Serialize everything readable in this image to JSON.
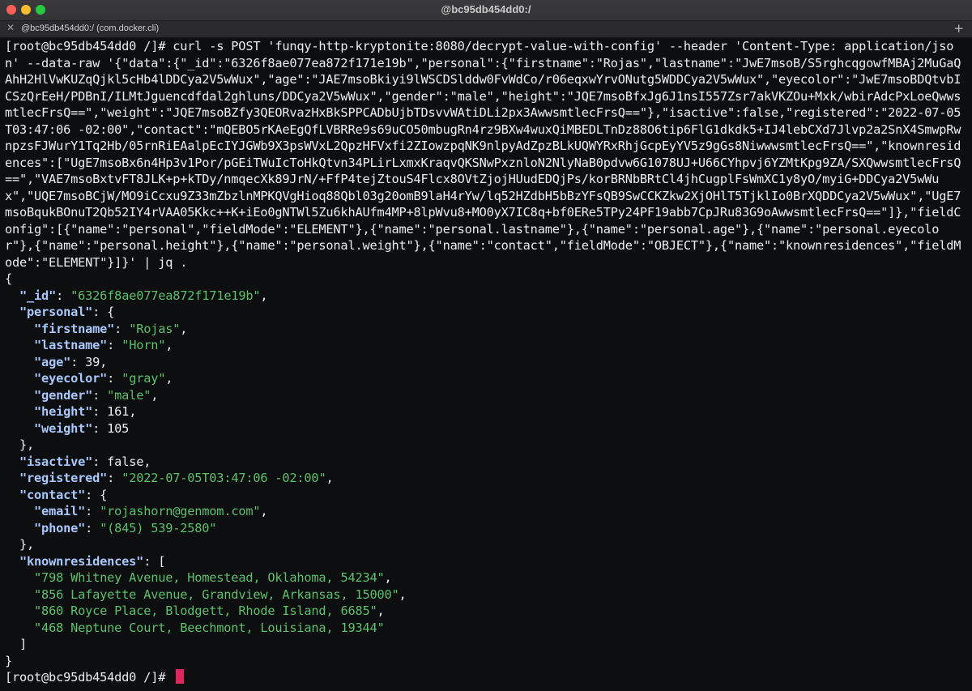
{
  "window": {
    "title": "@bc95db454dd0:/",
    "tab_title": "@bc95db454dd0:/ (com.docker.cli)",
    "tab_close": "✕",
    "tab_add": "+"
  },
  "terminal": {
    "command": "[root@bc95db454dd0 /]# curl -s POST 'funqy-http-kryptonite:8080/decrypt-value-with-config' --header 'Content-Type: application/json' --data-raw '{\"data\":{\"_id\":\"6326f8ae077ea872f171e19b\",\"personal\":{\"firstname\":\"Rojas\",\"lastname\":\"JwE7msoB/S5rghcqgowfMBAj2MuGaQAhH2HlVwKUZqQjkl5cHb4lDDCya2V5wWux\",\"age\":\"JAE7msoBkiyi9lWSCDSlddw0FvWdCo/r06eqxwYrvONutg5WDDCya2V5wWux\",\"eyecolor\":\"JwE7msoBDQtvbICSzQrEeH/PDBnI/ILMtJguencdfdal2ghluns/DDCya2V5wWux\",\"gender\":\"male\",\"height\":\"JQE7msoBfxJg6J1nsI557Zsr7akVKZOu+Mxk/wbirAdcPxLoeQwwsmtlecFrsQ==\",\"weight\":\"JQE7msoBZfy3QEORvazHxBkSPPCADbUjbTDsvvWAtiDLi2px3AwwsmtlecFrsQ==\"},\"isactive\":false,\"registered\":\"2022-07-05T03:47:06 -02:00\",\"contact\":\"mQEBO5rKAeEgQfLVBRRe9s69uCO50mbugRn4rz9BXw4wuxQiMBEDLTnDz88O6tip6FlG1dkdk5+IJ4lebCXd7Jlvp2a2SnX4SmwpRwnpzsFJWurY1Tq2Hb/05rnRiEAalpEcIYJGWb9X3psWVxL2QpzHFVxfi2ZIowzpqNK9nlpyAdZpzBLkUQWYRxRhjGcpEyYV5z9gGs8NiwwwsmtlecFrsQ==\",\"knownresidences\":[\"UgE7msoBx6n4Hp3v1Por/pGEiTWuIcToHkQtvn34PLirLxmxKraqvQKSNwPxznloN2NlyNaB0pdvw6G1078UJ+U66CYhpvj6YZMtKpg9ZA/SXQwwsmtlecFrsQ==\",\"VAE7msoBxtvFT8JLK+p+kTDy/nmqecXk89JrN/+FfP4tejZtouS4Flcx8OVtZjojHUudEDQjPs/korBRNbBRtCl4jhCugplFsWmXC1y8yO/myiG+DDCya2V5wWux\",\"UQE7msoBCjW/MO9iCcxu9Z33mZbzlnMPKQVgHioq88Qbl03g20omB9laH4rYw/lq52HZdbH5bBzYFsQB9SwCCKZkw2XjOHlT5TjklIo0BrXQDDCya2V5wWux\",\"UgE7msoBqukBOnuT2Qb52IY4rVAA05Kkc++K+iEo0gNTWl5Zu6khAUfm4MP+8lpWvu8+MO0yX7IC8q+bf0ERe5TPy24PF19abb7CpJRu83G9oAwwsmtlecFrsQ==\"]},\"fieldConfig\":[{\"name\":\"personal\",\"fieldMode\":\"ELEMENT\"},{\"name\":\"personal.lastname\"},{\"name\":\"personal.age\"},{\"name\":\"personal.eyecolor\"},{\"name\":\"personal.height\"},{\"name\":\"personal.weight\"},{\"name\":\"contact\",\"fieldMode\":\"OBJECT\"},{\"name\":\"knownresidences\",\"fieldMode\":\"ELEMENT\"}]}' | jq .",
    "output": {
      "id_key": "\"_id\"",
      "id_value": "\"6326f8ae077ea872f171e19b\"",
      "personal_key": "\"personal\"",
      "firstname_key": "\"firstname\"",
      "firstname_value": "\"Rojas\"",
      "lastname_key": "\"lastname\"",
      "lastname_value": "\"Horn\"",
      "age_key": "\"age\"",
      "age_value": "39",
      "eyecolor_key": "\"eyecolor\"",
      "eyecolor_value": "\"gray\"",
      "gender_key": "\"gender\"",
      "gender_value": "\"male\"",
      "height_key": "\"height\"",
      "height_value": "161",
      "weight_key": "\"weight\"",
      "weight_value": "105",
      "isactive_key": "\"isactive\"",
      "isactive_value": "false",
      "registered_key": "\"registered\"",
      "registered_value": "\"2022-07-05T03:47:06 -02:00\"",
      "contact_key": "\"contact\"",
      "email_key": "\"email\"",
      "email_value": "\"rojashorn@genmom.com\"",
      "phone_key": "\"phone\"",
      "phone_value": "\"(845) 539-2580\"",
      "knownresidences_key": "\"knownresidences\"",
      "residences": [
        "\"798 Whitney Avenue, Homestead, Oklahoma, 54234\"",
        "\"856 Lafayette Avenue, Grandview, Arkansas, 15000\"",
        "\"860 Royce Place, Blodgett, Rhode Island, 6685\"",
        "\"468 Neptune Court, Beechmont, Louisiana, 19344\""
      ]
    },
    "prompt": "[root@bc95db454dd0 /]# "
  }
}
